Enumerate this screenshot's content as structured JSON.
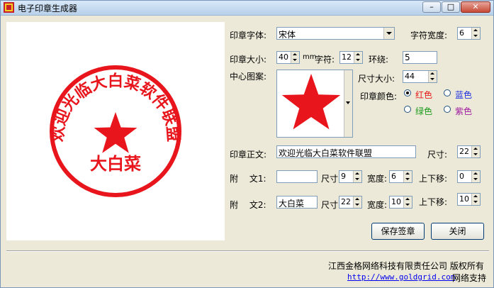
{
  "window": {
    "title": "电子印章生成器"
  },
  "stamp": {
    "ring_text": "欢迎光临大白菜软件联盟",
    "bottom_text": "大白菜",
    "color": "#e8161c"
  },
  "form": {
    "font_label": "印章字体:",
    "font_value": "宋体",
    "char_width_label": "字符宽度:",
    "char_width_value": "6",
    "size_label": "印章大小:",
    "size_value": "40",
    "size_unit": "mm",
    "char_label": "字符:",
    "char_value": "12",
    "ring_label": "环绕:",
    "ring_value": "5",
    "center_label": "中心图案:",
    "center_size_label": "尺寸大小:",
    "center_size_value": "44",
    "color_label": "印章颜色:",
    "colors": {
      "red": "红色",
      "blue": "蓝色",
      "green": "绿色",
      "purple": "紫色",
      "red_hex": "#e81818",
      "blue_hex": "#1a2fe0",
      "green_hex": "#1a9a1a",
      "purple_hex": "#a01ca0"
    },
    "main_text_label": "印章正文:",
    "main_text_value": "欢迎光临大白菜软件联盟",
    "main_size_label": "尺寸:",
    "main_size_value": "22",
    "sub1_label": "附　 文1:",
    "sub1_value": "",
    "sub1_size_label": "尺寸",
    "sub1_size_value": "9",
    "sub1_width_label": "宽度:",
    "sub1_width_value": "6",
    "sub1_offset_label": "上下移:",
    "sub1_offset_value": "0",
    "sub2_label": "附　 文2:",
    "sub2_value": "大白菜",
    "sub2_size_label": "尺寸",
    "sub2_size_value": "22",
    "sub2_width_label": "宽度:",
    "sub2_width_value": "10",
    "sub2_offset_label": "上下移:",
    "sub2_offset_value": "10"
  },
  "buttons": {
    "save": "保存签章",
    "close": "关闭"
  },
  "footer": {
    "company": "江西金格网络科技有限责任公司 版权所有",
    "url": "http://www.goldgrid.com",
    "support": "网络支持"
  }
}
